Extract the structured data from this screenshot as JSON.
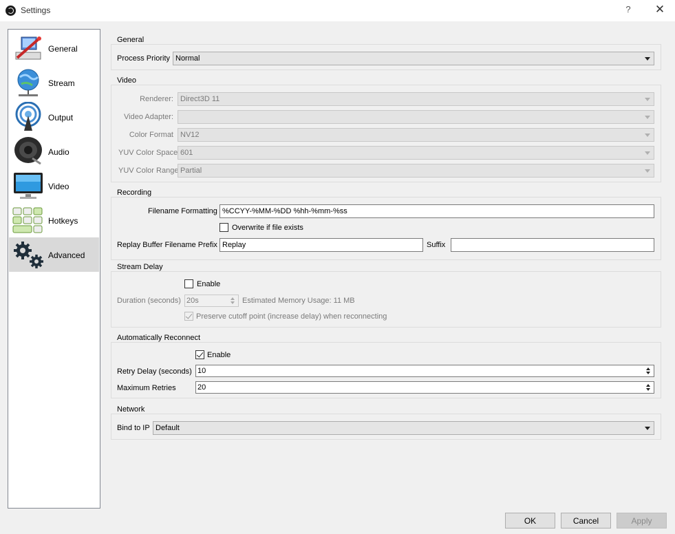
{
  "window": {
    "title": "Settings",
    "help_glyph": "?",
    "close_glyph": "✕"
  },
  "sidebar": {
    "items": [
      {
        "label": "General",
        "icon": "general-icon"
      },
      {
        "label": "Stream",
        "icon": "stream-icon"
      },
      {
        "label": "Output",
        "icon": "output-icon"
      },
      {
        "label": "Audio",
        "icon": "audio-icon"
      },
      {
        "label": "Video",
        "icon": "video-icon"
      },
      {
        "label": "Hotkeys",
        "icon": "hotkeys-icon"
      },
      {
        "label": "Advanced",
        "icon": "advanced-icon",
        "selected": true
      }
    ]
  },
  "general": {
    "title": "General",
    "process_priority_label": "Process Priority",
    "process_priority_value": "Normal"
  },
  "video": {
    "title": "Video",
    "renderer_label": "Renderer:",
    "renderer_value": "Direct3D 11",
    "adapter_label": "Video Adapter:",
    "adapter_value": "",
    "color_format_label": "Color Format",
    "color_format_value": "NV12",
    "color_space_label": "YUV Color Space",
    "color_space_value": "601",
    "color_range_label": "YUV Color Range",
    "color_range_value": "Partial"
  },
  "recording": {
    "title": "Recording",
    "filename_label": "Filename Formatting",
    "filename_value": "%CCYY-%MM-%DD %hh-%mm-%ss",
    "overwrite_label": "Overwrite if file exists",
    "overwrite_checked": false,
    "replay_prefix_label": "Replay Buffer Filename Prefix",
    "replay_prefix_value": "Replay",
    "suffix_label": "Suffix",
    "suffix_value": ""
  },
  "stream_delay": {
    "title": "Stream Delay",
    "enable_label": "Enable",
    "enable_checked": false,
    "duration_label": "Duration (seconds)",
    "duration_value": "20s",
    "memory_usage": "Estimated Memory Usage: 11 MB",
    "preserve_label": "Preserve cutoff point (increase delay) when reconnecting",
    "preserve_checked": true
  },
  "reconnect": {
    "title": "Automatically Reconnect",
    "enable_label": "Enable",
    "enable_checked": true,
    "retry_delay_label": "Retry Delay (seconds)",
    "retry_delay_value": "10",
    "max_retries_label": "Maximum Retries",
    "max_retries_value": "20"
  },
  "network": {
    "title": "Network",
    "bind_label": "Bind to IP",
    "bind_value": "Default"
  },
  "buttons": {
    "ok": "OK",
    "cancel": "Cancel",
    "apply": "Apply"
  }
}
